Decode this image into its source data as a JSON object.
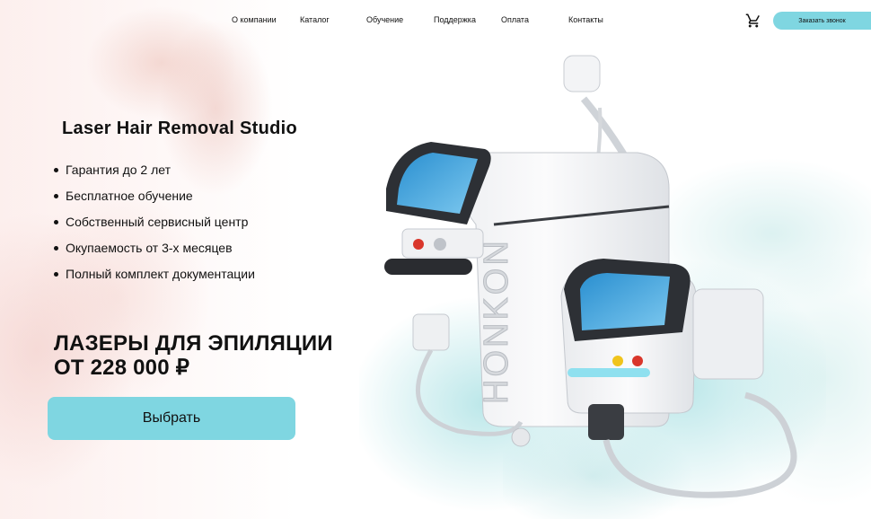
{
  "header": {
    "nav": [
      "О компании",
      "Каталог",
      "Обучение",
      "Поддержка",
      "Оплата",
      "Контакты"
    ],
    "call_button": "Заказать звонок",
    "cart_icon": "cart-icon"
  },
  "hero": {
    "studio_title": "Laser Hair Removal Studio",
    "features": [
      "Гарантия до 2 лет",
      "Бесплатное обучение",
      "Собственный сервисный центр",
      "Окупаемость от 3-х месяцев",
      "Полный комплект документации"
    ],
    "promo_line1": "Лазеры для эпиляции",
    "promo_line2": "от 228 000 ₽",
    "choose_button": "Выбрать"
  },
  "product": {
    "brand": "HONKON"
  },
  "colors": {
    "accent": "#7fd6e1",
    "text": "#111111"
  }
}
